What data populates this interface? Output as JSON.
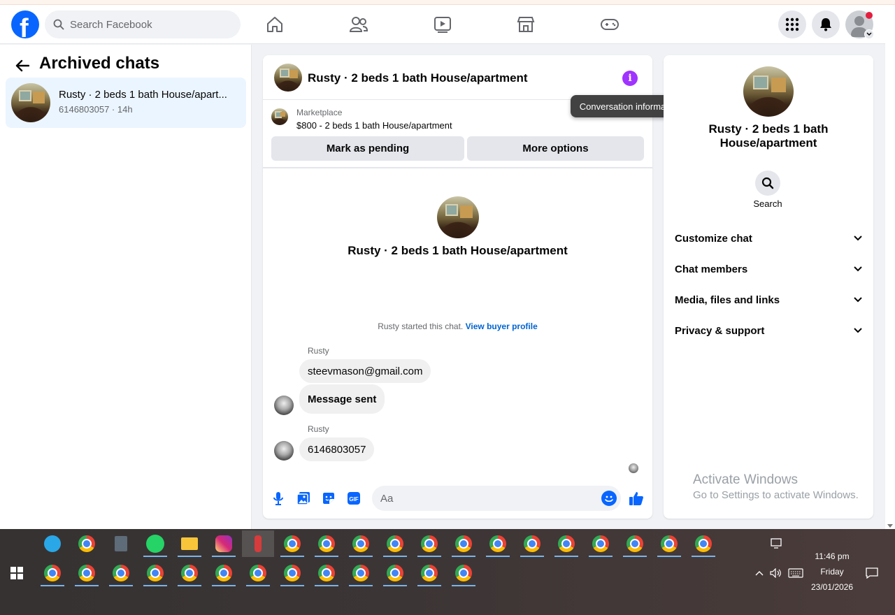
{
  "topbar": {
    "logo_letter": "f",
    "search_placeholder": "Search Facebook",
    "nav_icons": [
      "home-icon",
      "friends-icon",
      "video-icon",
      "marketplace-icon",
      "gaming-icon"
    ],
    "right_icons": [
      "menu-grid-icon",
      "notifications-icon",
      "account-avatar"
    ]
  },
  "sidebar": {
    "title": "Archived chats",
    "chats": [
      {
        "name": "Rusty · 2 beds 1 bath House/apart...",
        "meta": "6146803057 · 14h"
      }
    ]
  },
  "conversation": {
    "title": "Rusty · 2 beds 1 bath House/apartment",
    "listing": {
      "label": "Marketplace",
      "price_title": "$800 - 2 beds 1 bath House/apartment"
    },
    "buttons": {
      "pending": "Mark as pending",
      "more": "More options"
    },
    "intro_title": "Rusty · 2 beds 1 bath House/apartment",
    "started_text": "Rusty started this chat.",
    "buyer_link": "View buyer profile",
    "messages": [
      {
        "sender": "Rusty",
        "text": "steevmason@gmail.com"
      },
      {
        "sender": "",
        "text": "Message sent"
      },
      {
        "sender": "Rusty",
        "text": "6146803057"
      }
    ],
    "composer_placeholder": "Aa",
    "composer_icons": [
      "microphone-icon",
      "image-icon",
      "sticker-icon",
      "gif-icon",
      "emoji-icon",
      "like-icon"
    ],
    "gif_label": "GIF"
  },
  "tooltip": "Conversation information",
  "info_panel": {
    "title": "Rusty · 2 beds 1 bath House/apartment",
    "search_label": "Search",
    "sections": [
      "Customize chat",
      "Chat members",
      "Media, files and links",
      "Privacy & support"
    ]
  },
  "watermark": {
    "line1": "Activate Windows",
    "line2": "Go to Settings to activate Windows."
  },
  "taskbar": {
    "time": "11:46 pm",
    "day": "Friday",
    "date": "23/01/2026"
  },
  "colors": {
    "brand": "#0866ff",
    "info_accent": "#a033ff",
    "link": "#0064d1",
    "selected_chat": "#ebf5ff"
  }
}
